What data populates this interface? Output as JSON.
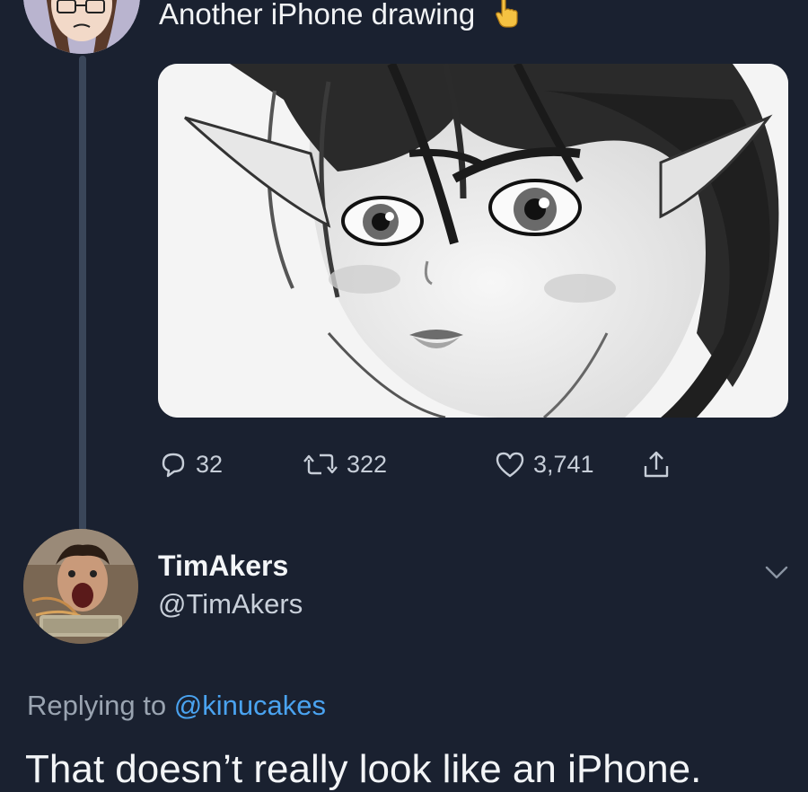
{
  "original_tweet": {
    "text": "Another iPhone drawing",
    "emoji_icon": "pointing-down-hand-emoji",
    "media": {
      "description_icon": "anime-elf-sketch-image"
    },
    "stats": {
      "replies": "32",
      "retweets": "322",
      "likes": "3,741"
    }
  },
  "reply_tweet": {
    "display_name": "TimAkers",
    "handle": "@TimAkers",
    "replying_prefix": "Replying to",
    "replying_to": "@kinucakes",
    "text": "That doesn’t really look like an iPhone."
  },
  "colors": {
    "background": "#1a2130",
    "thread_line": "#3a4659",
    "mention": "#4aa3f0",
    "secondary_text": "#9aa4b1"
  }
}
